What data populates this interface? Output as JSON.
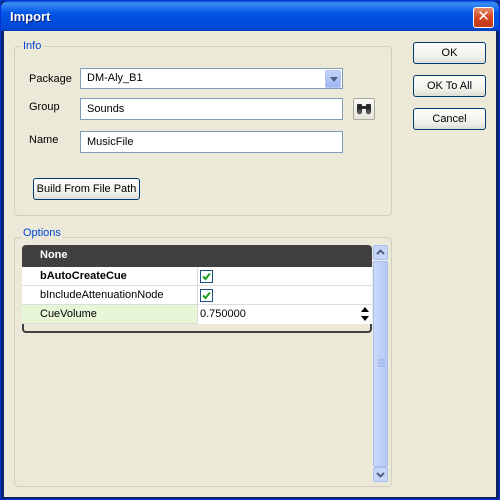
{
  "window": {
    "title": "Import",
    "close_glyph": "✕"
  },
  "info": {
    "legend": "Info",
    "package_label": "Package",
    "package_value": "DM-Aly_B1",
    "group_label": "Group",
    "group_value": "Sounds",
    "name_label": "Name",
    "name_value": "MusicFile",
    "build_button": "Build From File Path",
    "browse_icon": "binoculars-icon"
  },
  "buttons": {
    "ok": "OK",
    "ok_to_all": "OK To All",
    "cancel": "Cancel"
  },
  "options": {
    "legend": "Options",
    "category": "None",
    "rows": [
      {
        "name": "bAutoCreateCue",
        "type": "checkbox",
        "checked": true
      },
      {
        "name": "bIncludeAttenuationNode",
        "type": "checkbox",
        "checked": true
      },
      {
        "name": "CueVolume",
        "type": "number",
        "value": "0.750000"
      }
    ]
  },
  "colors": {
    "title_bar": "#0055e5",
    "legend_text": "#0046d5",
    "grid_header": "#404040",
    "highlight_row": "#e8f6d8"
  }
}
